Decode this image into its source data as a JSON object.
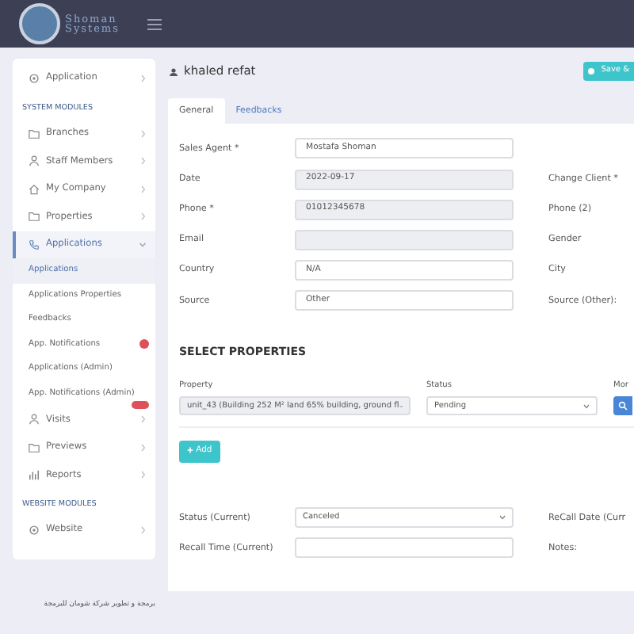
{
  "topbar": {
    "logo": [
      "Shoman",
      "Systems"
    ]
  },
  "sidebar": [
    {
      "kind": "item",
      "label": "Application",
      "selected": false,
      "expanded": false
    },
    {
      "kind": "heading",
      "label": "SYSTEM MODULES"
    },
    {
      "kind": "item",
      "label": "Branches",
      "selected": false,
      "expanded": false
    },
    {
      "kind": "item",
      "label": "Staff Members",
      "selected": false,
      "expanded": false
    },
    {
      "kind": "item",
      "label": "My Company",
      "selected": false,
      "expanded": false
    },
    {
      "kind": "item",
      "label": "Properties",
      "selected": false,
      "expanded": false
    },
    {
      "kind": "item",
      "label": "Applications",
      "selected": true,
      "expanded": true,
      "children": [
        {
          "label": "Applications",
          "selected": true,
          "badge": false
        },
        {
          "label": "Applications Properties",
          "selected": false,
          "badge": false
        },
        {
          "label": "Feedbacks",
          "selected": false,
          "badge": false
        },
        {
          "label": "App. Notifications",
          "selected": false,
          "badge": true
        },
        {
          "label": "Applications (Admin)",
          "selected": false,
          "badge": false
        },
        {
          "label": "App. Notifications (Admin)",
          "selected": false,
          "badge": true
        }
      ]
    },
    {
      "kind": "item",
      "label": "Visits",
      "selected": false,
      "expanded": false
    },
    {
      "kind": "item",
      "label": "Previews",
      "selected": false,
      "expanded": false
    },
    {
      "kind": "item",
      "label": "Reports",
      "selected": false,
      "expanded": false
    },
    {
      "kind": "heading",
      "label": "WEBSITE MODULES"
    },
    {
      "kind": "item",
      "label": "Website",
      "selected": false,
      "expanded": false
    }
  ],
  "footer": "برمجة و تطوير شركة شومان للبرمجة",
  "title": "khaled refat",
  "save_button": "Save &",
  "tabs": [
    {
      "label": "General",
      "selected": true
    },
    {
      "label": "Feedbacks",
      "selected": false
    }
  ],
  "fields": [
    {
      "label": "Sales Agent *",
      "value": "Mostafa Shoman",
      "disabled": false
    },
    {
      "label": "Date",
      "value": "2022-09-17",
      "disabled": true,
      "right_label": "Change Client *"
    },
    {
      "label": "Phone *",
      "value": "01012345678",
      "disabled": true,
      "right_label": "Phone (2)"
    },
    {
      "label": "Email",
      "disabled": true,
      "right_label": "Gender"
    },
    {
      "label": "Country",
      "value": "N/A",
      "disabled": false,
      "right_label": "City"
    },
    {
      "label": "Source",
      "value": "Other",
      "disabled": false,
      "right_label": "Source (Other):"
    }
  ],
  "select_properties": {
    "heading": "SELECT PROPERTIES",
    "property": {
      "label": "Property",
      "value": "unit_43 (Building 252 M² land 65% building, ground fl",
      "disabled": true
    },
    "status": {
      "label": "Status",
      "value": "Pending",
      "disabled": false
    },
    "more_label": "Mor",
    "add_button": "Add"
  },
  "current": [
    {
      "label": "Status (Current)",
      "kind": "select",
      "value": "Canceled",
      "right_label": "ReCall Date (Curr"
    },
    {
      "label": "Recall Time (Current)",
      "kind": "input",
      "right_label": "Notes:"
    }
  ]
}
